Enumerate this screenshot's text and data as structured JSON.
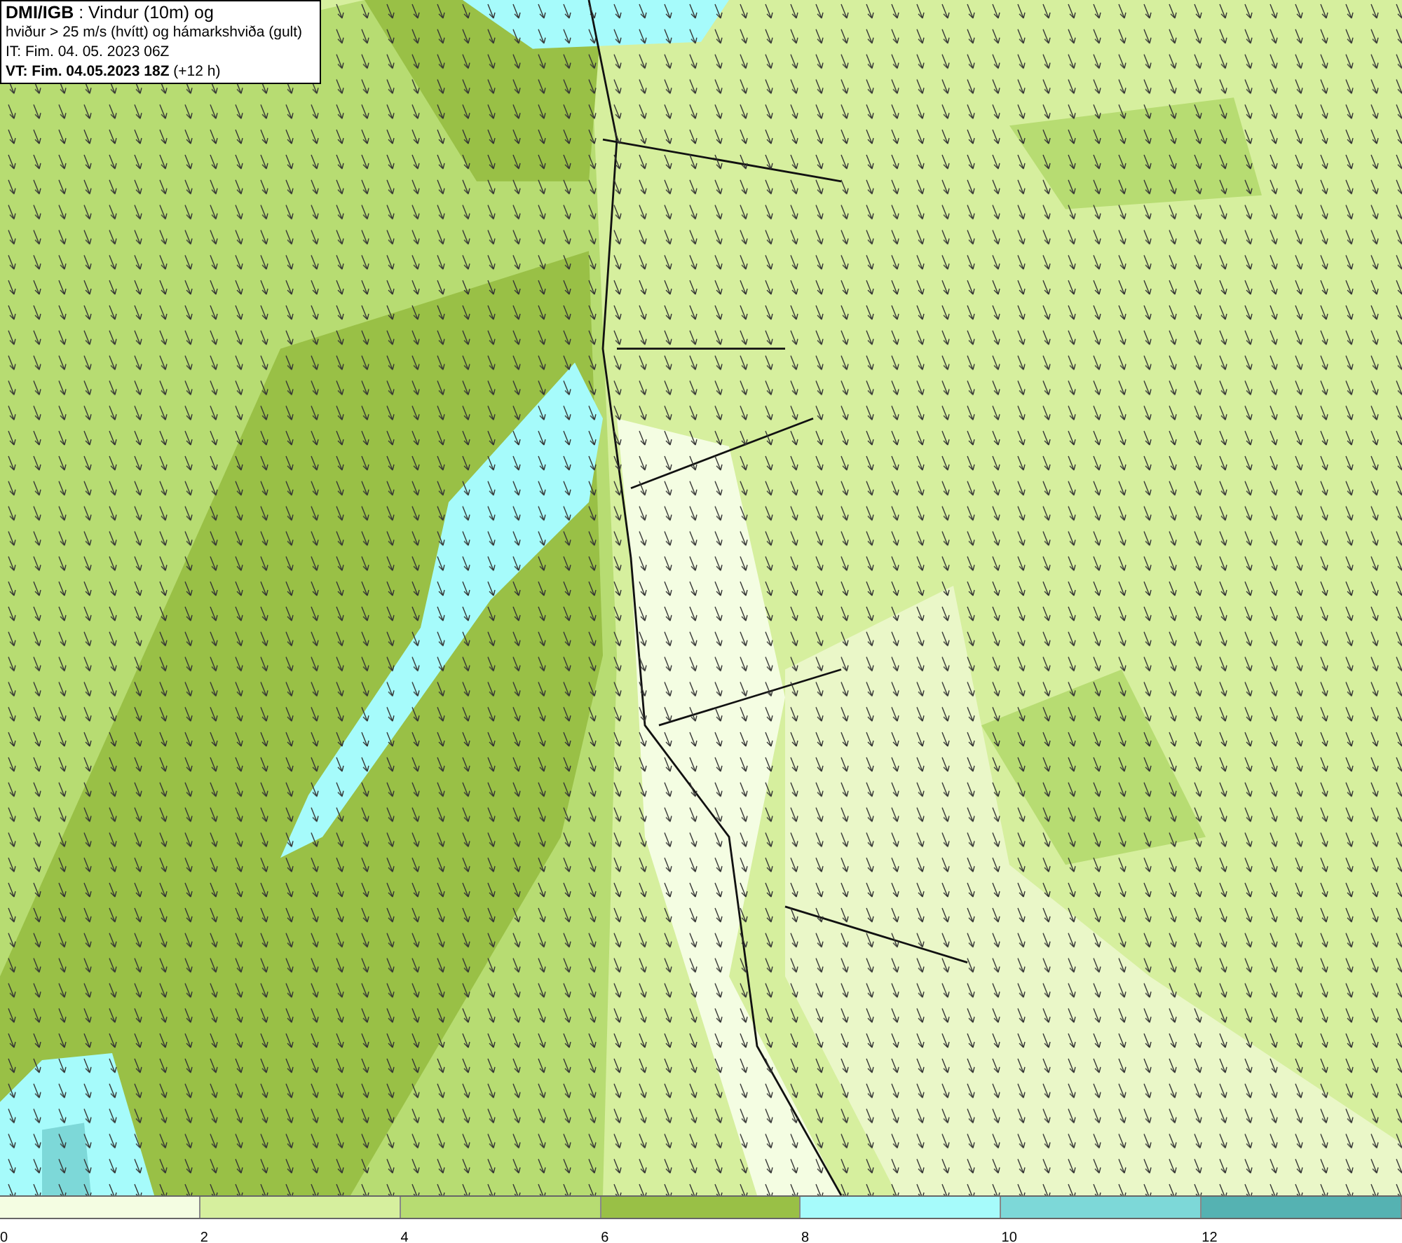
{
  "legend": {
    "lines": [
      "**DMI/IGB** : Vindur (10m) og",
      "hviður > 25 m/s (hvítt) og hámarkshviða (gult)",
      "IT: Fim. 04. 05. 2023 06Z",
      "**VT: Fim. 04.05.2023 18Z** (+12 h)"
    ]
  },
  "color_scale": {
    "segments": [
      {
        "label": "0",
        "color": "#f4fde2"
      },
      {
        "label": "2",
        "color": "#d6ef9e"
      },
      {
        "label": "4",
        "color": "#b7dc72"
      },
      {
        "label": "6",
        "color": "#99c046"
      },
      {
        "label": "8",
        "color": "#a6fbfb"
      },
      {
        "label": "10",
        "color": "#7dd8d8"
      },
      {
        "label": "12",
        "color": "#55b2b2"
      }
    ]
  }
}
